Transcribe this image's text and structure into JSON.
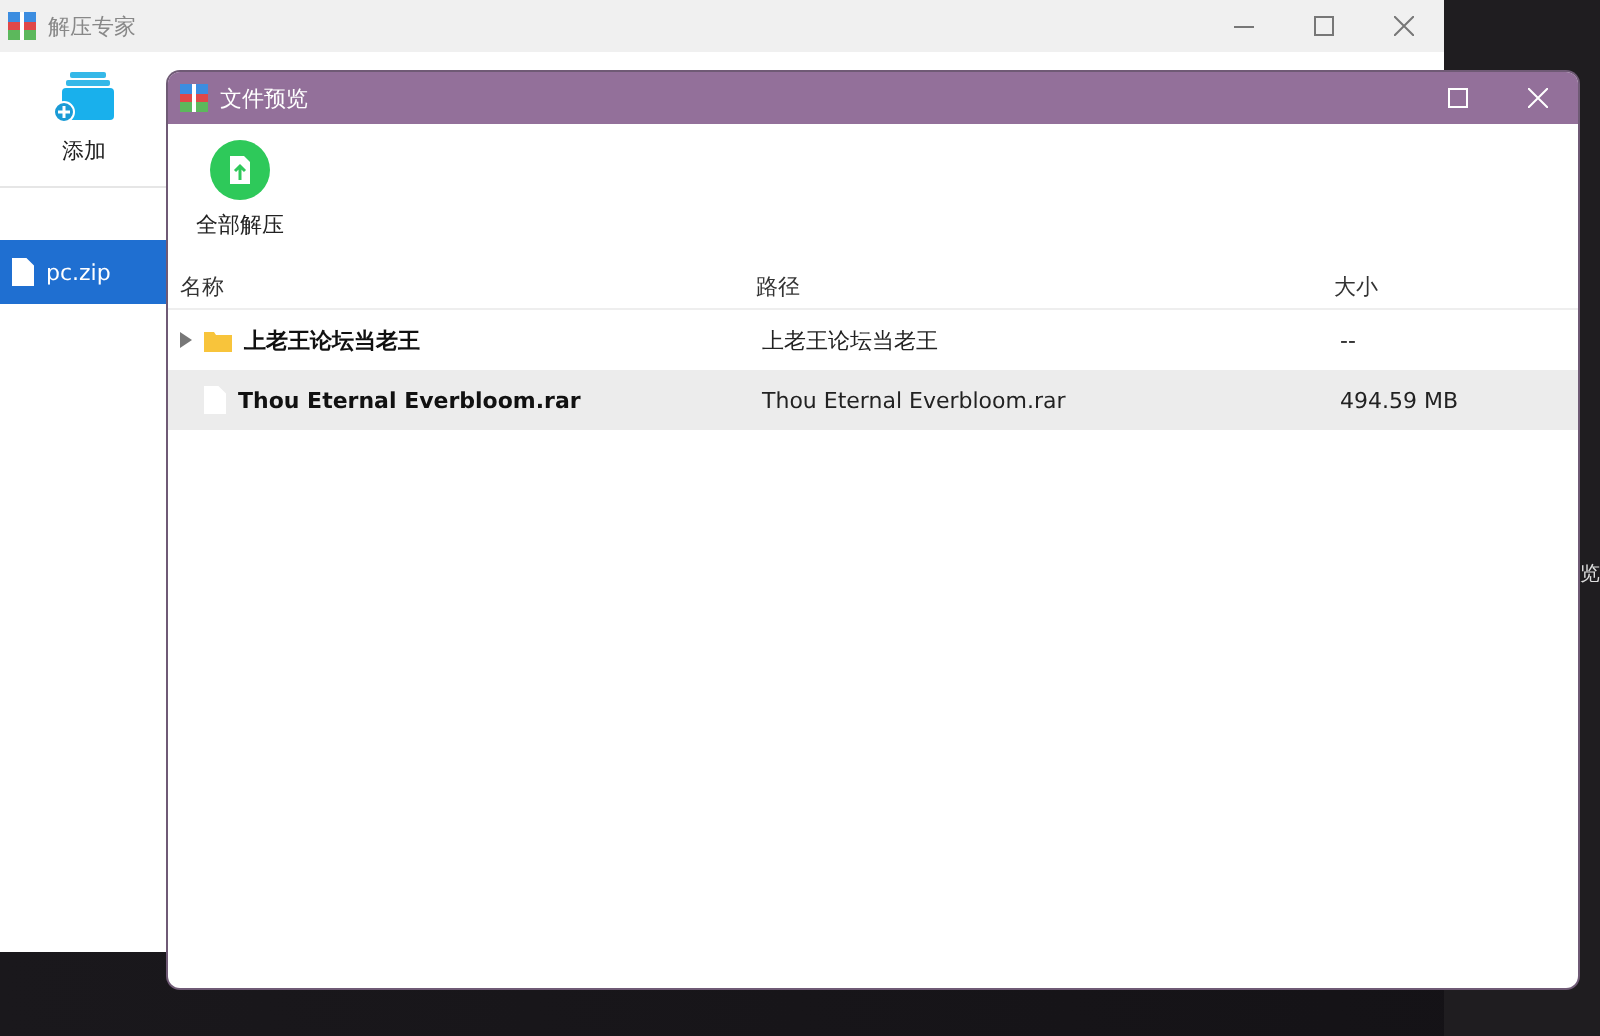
{
  "back_window": {
    "title": "解压专家",
    "toolbar": [
      {
        "label": "添加"
      }
    ],
    "archives": [
      {
        "name": "pc.zip",
        "selected": true
      }
    ]
  },
  "preview_window": {
    "title": "文件预览",
    "toolbar": [
      {
        "label": "全部解压"
      }
    ],
    "table": {
      "columns": [
        "名称",
        "路径",
        "大小"
      ],
      "rows": [
        {
          "kind": "folder",
          "name": "上老王论坛当老王",
          "path": "上老王论坛当老王",
          "size": "--",
          "expanded": false,
          "selected": false
        },
        {
          "kind": "file",
          "name": "Thou Eternal Everbloom.rar",
          "path": "Thou Eternal Everbloom.rar",
          "size": "494.59 MB",
          "selected": true
        }
      ]
    }
  },
  "desktop_fragment": "览"
}
